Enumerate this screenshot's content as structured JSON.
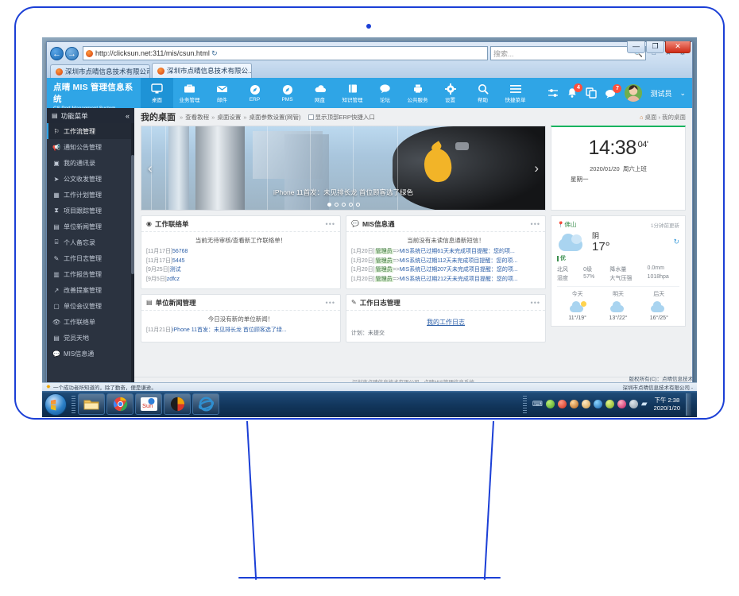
{
  "browser": {
    "back_label": "←",
    "forward_label": "→",
    "url": "http://clicksun.net:311/mis/csun.html",
    "url_bold": "clicksun.net",
    "refresh_icon": "↻",
    "search_placeholder": "搜索...",
    "search_icon": "🔍",
    "home_icon": "⌂",
    "fav_icon": "★",
    "settings_icon": "⚙",
    "minimize_label": "—",
    "maximize_label": "❐",
    "close_label": "✕",
    "tabs": [
      {
        "title": "深圳市点晴信息技术有限公司...",
        "active": false
      },
      {
        "title": "深圳市点晴信息技术有限公...",
        "active": true,
        "close": "✕"
      }
    ]
  },
  "appbar": {
    "brand_cn": "点晴 MIS 管理信息系统",
    "brand_en": "CS Port Managment System",
    "nav": [
      {
        "label": "桌面",
        "icon": "monitor-icon",
        "active": true
      },
      {
        "label": "业务管理",
        "icon": "briefcase-icon",
        "active": false
      },
      {
        "label": "邮件",
        "icon": "mail-icon",
        "active": false
      },
      {
        "label": "ERP",
        "icon": "compass-icon",
        "active": false
      },
      {
        "label": "PMS",
        "icon": "compass-icon",
        "active": false
      },
      {
        "label": "网盘",
        "icon": "cloud-icon",
        "active": false
      },
      {
        "label": "知识管理",
        "icon": "book-icon",
        "active": false
      },
      {
        "label": "论坛",
        "icon": "chat-bubble-icon",
        "active": false
      },
      {
        "label": "公共服务",
        "icon": "printer-icon",
        "active": false
      },
      {
        "label": "设置",
        "icon": "gear-icon",
        "active": false
      },
      {
        "label": "帮助",
        "icon": "search-icon",
        "active": false
      },
      {
        "label": "快捷菜单",
        "icon": "hamburger-icon",
        "active": false
      }
    ],
    "sliders_icon": "⇄",
    "bell_badge": "4",
    "copy_icon": "❏",
    "chat_badge": "7",
    "username": "测试员",
    "caret": "⌄"
  },
  "sidebar": {
    "header": "功能菜单",
    "collapse_icon": "«",
    "items": [
      {
        "label": "工作流管理",
        "icon": "flag-icon",
        "active": true
      },
      {
        "label": "通知公告管理",
        "icon": "megaphone-icon",
        "active": false
      },
      {
        "label": "我的通讯录",
        "icon": "contacts-icon",
        "active": false
      },
      {
        "label": "公文收发管理",
        "icon": "send-icon",
        "active": false
      },
      {
        "label": "工作计划管理",
        "icon": "calendar-icon",
        "active": false
      },
      {
        "label": "项目跟踪管理",
        "icon": "hourglass-icon",
        "active": false
      },
      {
        "label": "单位新闻管理",
        "icon": "news-icon",
        "active": false
      },
      {
        "label": "个人备忘录",
        "icon": "bookmark-icon",
        "active": false
      },
      {
        "label": "工作日志管理",
        "icon": "edit-icon",
        "active": false
      },
      {
        "label": "工作报告管理",
        "icon": "chart-icon",
        "active": false
      },
      {
        "label": "改善提案管理",
        "icon": "external-link-icon",
        "active": false
      },
      {
        "label": "单位会议管理",
        "icon": "square-icon",
        "active": false
      },
      {
        "label": "工作联络单",
        "icon": "eye-icon",
        "active": false
      },
      {
        "label": "党员天地",
        "icon": "book2-icon",
        "active": false
      },
      {
        "label": "MIS信息通",
        "icon": "message-icon",
        "active": false
      }
    ]
  },
  "crumb": {
    "title": "我的桌面",
    "sep": "»",
    "links": [
      "查看教程",
      "桌面设置",
      "桌面参数设置(网管)"
    ],
    "checkbox_label": "显示顶部ERP快捷入口",
    "home_icon": "⌂",
    "right_path": [
      "桌面",
      "我的桌面"
    ],
    "right_sep": "›"
  },
  "carousel": {
    "caption": "iPhone 11首发：未见排长龙 首位顾客选了绿色",
    "prev": "‹",
    "next": "›",
    "dots": 5,
    "active_dot": 0
  },
  "cards": [
    {
      "title": "工作联络单",
      "icon": "eye-icon",
      "dots": "•••",
      "empty": "当前无待审核/查看新工作联络单！",
      "empty_underline": "工作联络单",
      "items": [
        {
          "date": "[11月17日]",
          "text": "56768"
        },
        {
          "date": "[11月17日]",
          "text": "5445"
        },
        {
          "date": "[9月25日]",
          "text": "测试"
        },
        {
          "date": "[9月5日]",
          "text": "zdfcz"
        }
      ]
    },
    {
      "title": "MIS信息通",
      "icon": "message-icon",
      "dots": "•••",
      "empty": "当前没有未读信息通新短信！",
      "items": [
        {
          "date": "[1月20日]",
          "tag": "管理员",
          "arrow": "=>",
          "text": "MIS系统已过期61天未完成项目提醒：您的项..."
        },
        {
          "date": "[1月20日]",
          "tag": "管理员",
          "arrow": "=>",
          "text": "MIS系统已过期112天未完成项目提醒：您的项..."
        },
        {
          "date": "[1月20日]",
          "tag": "管理员",
          "arrow": "=>",
          "text": "MIS系统已过期207天未完成项目提醒：您的项..."
        },
        {
          "date": "[1月20日]",
          "tag": "管理员",
          "arrow": "=>",
          "text": "MIS系统已过期212天未完成项目提醒：您的项..."
        }
      ]
    },
    {
      "title": "单位新闻管理",
      "icon": "news-icon",
      "dots": "•••",
      "empty": "今日没有新的单位新闻！",
      "items": [
        {
          "date": "[11月21日]",
          "text": "iPhone 11首发：未见排长龙 首位顾客选了绿..."
        }
      ]
    },
    {
      "title": "工作日志管理",
      "icon": "edit-icon",
      "dots": "•••",
      "link": "我的工作日志",
      "plan": "计划：未提交"
    }
  ],
  "clock": {
    "time": "14:38",
    "seconds": "04'",
    "date": "2020/01/20",
    "shift": "周六上班",
    "weekday": "星期一"
  },
  "weather": {
    "city": "佛山",
    "city_icon": "pin-icon",
    "updated": "1分钟前更新",
    "condition": "阴",
    "temp": "17°",
    "refresh_icon": "↻",
    "air_quality": "优",
    "metrics": [
      {
        "k": "北风",
        "v": "0级"
      },
      {
        "k": "降水量",
        "v": "0.0mm"
      },
      {
        "k": "湿度",
        "v": "57%"
      },
      {
        "k": "大气压强",
        "v": "1018hpa"
      }
    ],
    "forecast": [
      {
        "day": "今天",
        "range": "11°/19°",
        "icon": "sun-cloud-icon"
      },
      {
        "day": "明天",
        "range": "13°/22°",
        "icon": "cloud-icon"
      },
      {
        "day": "后天",
        "range": "16°/25°",
        "icon": "cloud-icon"
      }
    ]
  },
  "page_footer": "深圳市点晴信息技术有限公司 - 点晴MIS管理信息系统",
  "statusbar": {
    "star_icon": "✸",
    "quote": "一个成功者所知道的，除了勤奋，便是谦逊。",
    "right": "深圳市点晴信息技术有限公司 -"
  },
  "statusbar2": {
    "copyright": "版权所有(C)：点晴信息技术"
  },
  "taskbar": {
    "start_label": "start-orb",
    "buttons": [
      "explorer-icon",
      "chrome-icon",
      "clicksun-icon",
      "maxthon-icon",
      "ie-icon"
    ],
    "time": "下午 2:38",
    "date": "2020/1/20"
  }
}
